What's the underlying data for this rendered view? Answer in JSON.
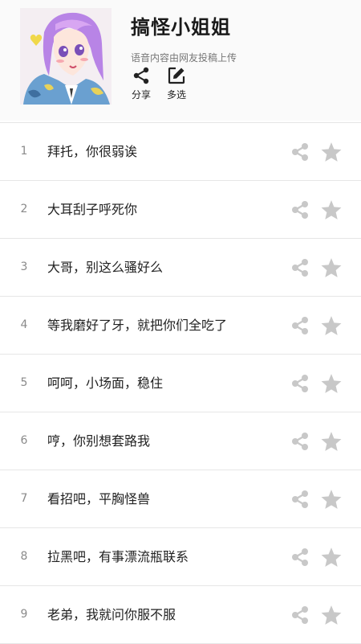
{
  "header": {
    "title": "搞怪小姐姐",
    "subtitle": "语音内容由网友投稿上传",
    "actions": {
      "share_label": "分享",
      "multi_label": "多选"
    }
  },
  "items": [
    {
      "num": "1",
      "text": "拜托，你很弱诶"
    },
    {
      "num": "2",
      "text": "大耳刮子呼死你"
    },
    {
      "num": "3",
      "text": "大哥，别这么骚好么"
    },
    {
      "num": "4",
      "text": "等我磨好了牙，就把你们全吃了"
    },
    {
      "num": "5",
      "text": "呵呵，小场面，稳住"
    },
    {
      "num": "6",
      "text": "哼，你别想套路我"
    },
    {
      "num": "7",
      "text": "看招吧，平胸怪兽"
    },
    {
      "num": "8",
      "text": "拉黑吧，有事漂流瓶联系"
    },
    {
      "num": "9",
      "text": "老弟，我就问你服不服"
    }
  ],
  "colors": {
    "icon_gray": "#c8c8c8",
    "divider": "#e6e6e6"
  }
}
